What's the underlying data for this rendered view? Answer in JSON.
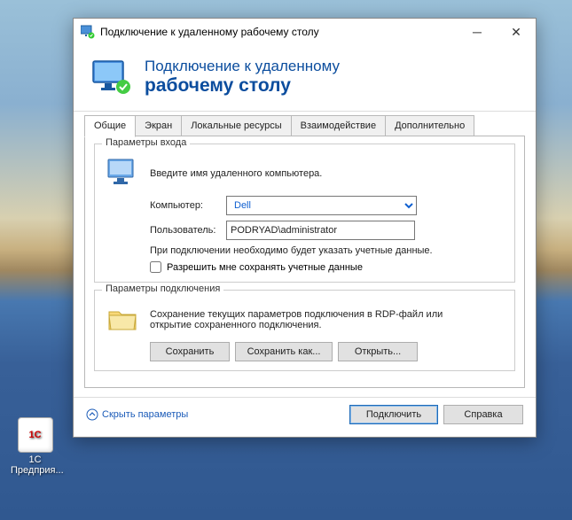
{
  "desktop": {
    "icon_label": "1С",
    "icon_text_line1": "1С",
    "icon_text_line2": "Предприя..."
  },
  "titlebar": {
    "title": "Подключение к удаленному рабочему столу"
  },
  "header": {
    "line1": "Подключение к удаленному",
    "line2": "рабочему столу"
  },
  "tabs": [
    {
      "label": "Общие",
      "active": true
    },
    {
      "label": "Экран",
      "active": false
    },
    {
      "label": "Локальные ресурсы",
      "active": false
    },
    {
      "label": "Взаимодействие",
      "active": false
    },
    {
      "label": "Дополнительно",
      "active": false
    }
  ],
  "login_group": {
    "title": "Параметры входа",
    "intro": "Введите имя удаленного компьютера.",
    "computer_label": "Компьютер:",
    "computer_value": "Dell",
    "user_label": "Пользователь:",
    "user_value": "PODRYAD\\administrator",
    "note": "При подключении необходимо будет указать учетные данные.",
    "checkbox_label": "Разрешить мне сохранять учетные данные"
  },
  "conn_group": {
    "title": "Параметры подключения",
    "desc": "Сохранение текущих параметров подключения в RDP-файл или открытие сохраненного подключения.",
    "save": "Сохранить",
    "save_as": "Сохранить как...",
    "open": "Открыть..."
  },
  "footer": {
    "collapse": "Скрыть параметры",
    "connect": "Подключить",
    "help": "Справка"
  }
}
